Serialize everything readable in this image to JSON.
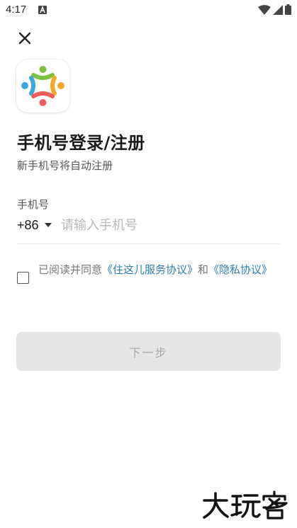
{
  "status_bar": {
    "time": "4:17",
    "notification_icon": "a-box-icon",
    "icons": [
      "wifi-icon",
      "signal-icon",
      "battery-icon"
    ]
  },
  "header": {
    "close_icon": "close-icon"
  },
  "logo": {
    "name": "app-logo",
    "colors": {
      "green": "#7cc23e",
      "blue": "#3aa8e0",
      "orange": "#f6a623",
      "red": "#ef5b5b"
    }
  },
  "title": "手机号登录/注册",
  "subtitle": "新手机号将自动注册",
  "phone": {
    "label": "手机号",
    "country_code": "+86",
    "placeholder": "请输入手机号",
    "value": ""
  },
  "agreement": {
    "prefix": "已阅读并同意",
    "service_link": "《住这儿服务协议》",
    "conjunction": "和",
    "privacy_link": "《隐私协议》"
  },
  "next_button": {
    "label": "下一步"
  },
  "watermark": {
    "text": "大玩客"
  },
  "colors": {
    "link": "#2b7fad",
    "button_bg": "#e6e6e9",
    "button_text": "#a6a6a6"
  }
}
